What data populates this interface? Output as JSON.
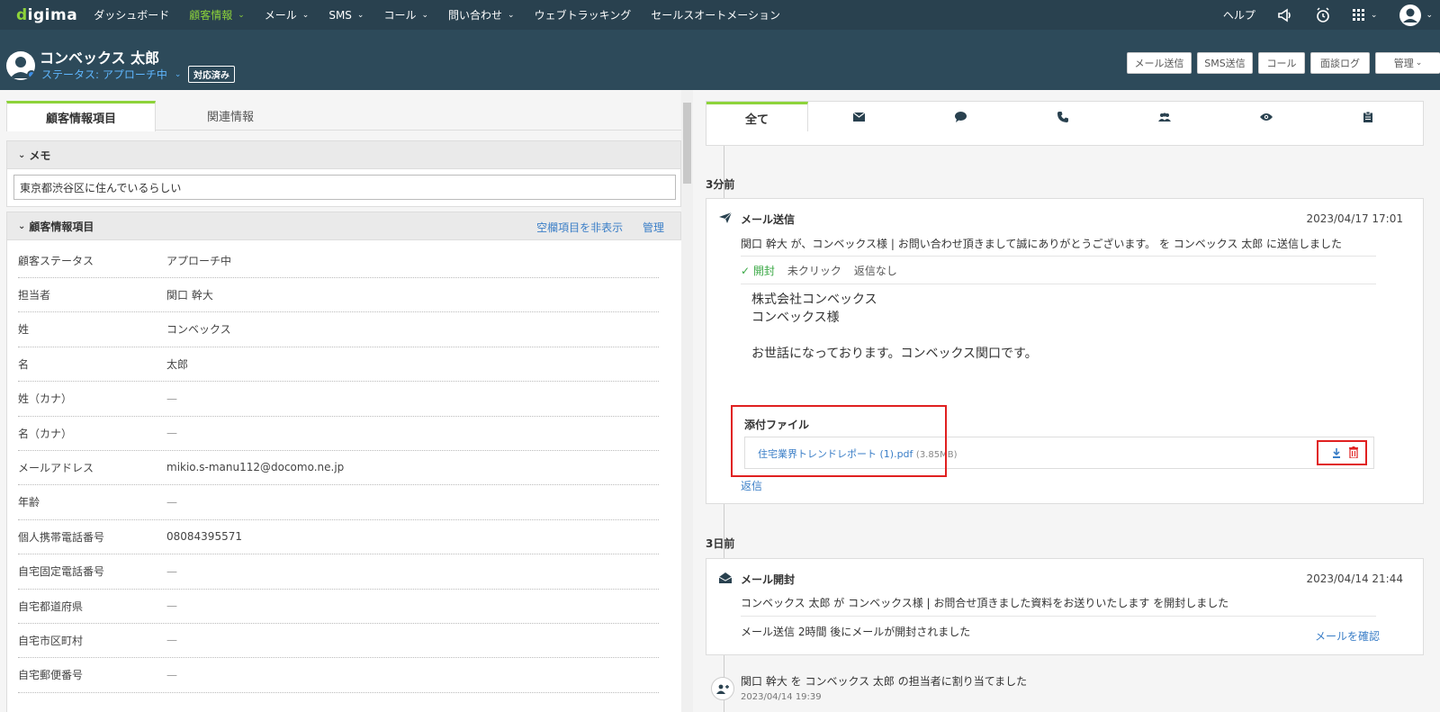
{
  "nav": {
    "logo": "digima",
    "items": [
      {
        "label": "ダッシュボード",
        "chev": false,
        "active": false
      },
      {
        "label": "顧客情報",
        "chev": true,
        "active": true
      },
      {
        "label": "メール",
        "chev": true,
        "active": false
      },
      {
        "label": "SMS",
        "chev": true,
        "active": false
      },
      {
        "label": "コール",
        "chev": true,
        "active": false
      },
      {
        "label": "問い合わせ",
        "chev": true,
        "active": false
      },
      {
        "label": "ウェブトラッキング",
        "chev": false,
        "active": false
      },
      {
        "label": "セールスオートメーション",
        "chev": false,
        "active": false
      }
    ],
    "help": "ヘルプ"
  },
  "header": {
    "name": "コンベックス 太郎",
    "status": "ステータス: アプローチ中",
    "badge": "対応済み",
    "buttons": {
      "mail": "メール送信",
      "sms": "SMS送信",
      "call": "コール",
      "meeting": "面談ログ",
      "manage": "管理"
    }
  },
  "left": {
    "tabs": {
      "info": "顧客情報項目",
      "related": "関連情報"
    },
    "memo": {
      "title": "メモ",
      "value": "東京都渋谷区に住んでいるらしい"
    },
    "fields_section": {
      "title": "顧客情報項目",
      "hide_empty": "空欄項目を非表示",
      "manage": "管理"
    },
    "fields": [
      {
        "label": "顧客ステータス",
        "value": "アプローチ中"
      },
      {
        "label": "担当者",
        "value": "関口 幹大"
      },
      {
        "label": "姓",
        "value": "コンベックス"
      },
      {
        "label": "名",
        "value": "太郎"
      },
      {
        "label": "姓（カナ）",
        "value": "—"
      },
      {
        "label": "名（カナ）",
        "value": "—"
      },
      {
        "label": "メールアドレス",
        "value": "mikio.s-manu112@docomo.ne.jp"
      },
      {
        "label": "年齢",
        "value": "—"
      },
      {
        "label": "個人携帯電話番号",
        "value": "08084395571"
      },
      {
        "label": "自宅固定電話番号",
        "value": "—"
      },
      {
        "label": "自宅都道府県",
        "value": "—"
      },
      {
        "label": "自宅市区町村",
        "value": "—"
      },
      {
        "label": "自宅郵便番号",
        "value": "—"
      }
    ]
  },
  "right": {
    "tabs": {
      "all": "全て"
    },
    "groups": {
      "g1": {
        "time": "3分前",
        "title": "メール送信",
        "date": "2023/04/17 17:01",
        "desc": "関口 幹大 が、コンベックス様 | お問い合わせ頂きまして誠にありがとうございます。 を コンベックス 太郎 に送信しました",
        "status_open": "開封",
        "status_click": "未クリック",
        "status_reply": "返信なし",
        "body1": "株式会社コンベックス",
        "body2": "コンベックス様",
        "body3": "お世話になっております。コンベックス関口です。",
        "attach_title": "添付ファイル",
        "attach_name": "住宅業界トレンドレポート (1).pdf",
        "attach_size": "(3.85MB)",
        "reply": "返信"
      },
      "g2": {
        "time": "3日前",
        "title": "メール開封",
        "date": "2023/04/14 21:44",
        "desc": "コンベックス 太郎 が コンベックス様 | お問合せ頂きました資料をお送りいたします を開封しました",
        "sub": "メール送信 2時間 後にメールが開封されました",
        "confirm": "メールを確認"
      },
      "g3": {
        "desc": "関口 幹大 を コンベックス 太郎 の担当者に割り当てました",
        "date": "2023/04/14 19:39"
      }
    }
  }
}
